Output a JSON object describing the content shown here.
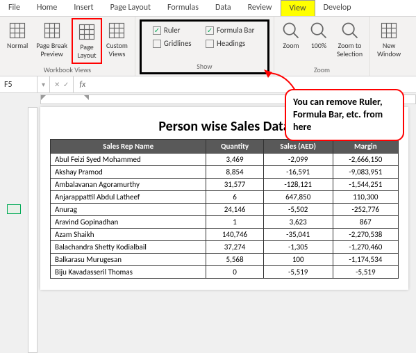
{
  "tabs": [
    "File",
    "Home",
    "Insert",
    "Page Layout",
    "Formulas",
    "Data",
    "Review",
    "View",
    "Develop"
  ],
  "active_tab": "View",
  "groups": {
    "workbook": {
      "label": "Workbook Views",
      "items": [
        "Normal",
        "Page Break\nPreview",
        "Page\nLayout",
        "Custom\nViews"
      ]
    },
    "show": {
      "label": "Show",
      "opts": [
        {
          "l": "Ruler",
          "c": true
        },
        {
          "l": "Formula Bar",
          "c": true
        },
        {
          "l": "Gridlines",
          "c": false
        },
        {
          "l": "Headings",
          "c": false
        }
      ]
    },
    "zoom": {
      "label": "Zoom",
      "items": [
        "Zoom",
        "100%",
        "Zoom to\nSelection"
      ]
    },
    "window": {
      "items": [
        "New\nWindow"
      ]
    }
  },
  "namebox": "F5",
  "fx": "fx",
  "callout": "You can remove Ruler, Formula Bar, etc. from here",
  "chart_data": {
    "type": "table",
    "title": "Person wise Sales Data",
    "columns": [
      "Sales Rep Name",
      "Quantity",
      "Sales (AED)",
      "Margin"
    ],
    "rows": [
      [
        "Abul Feizi Syed Mohammed",
        "3,469",
        "-2,099",
        "-2,666,150"
      ],
      [
        "Akshay Pramod",
        "8,854",
        "-16,591",
        "-9,083,951"
      ],
      [
        "Ambalavanan Agoramurthy",
        "31,577",
        "-128,121",
        "-1,544,251"
      ],
      [
        "Anjarappattil Abdul Latheef",
        "6",
        "647,850",
        "110,300"
      ],
      [
        "Anurag",
        "24,146",
        "-5,502",
        "-252,776"
      ],
      [
        "Aravind Gopinadhan",
        "1",
        "3,623",
        "867"
      ],
      [
        "Azam Shaikh",
        "140,746",
        "-35,041",
        "-2,270,538"
      ],
      [
        "Balachandra Shetty Kodialbail",
        "37,274",
        "-1,305",
        "-1,270,460"
      ],
      [
        "Balkarasu Murugesan",
        "5,568",
        "100",
        "-1,174,534"
      ],
      [
        "Biju Kavadasseril Thomas",
        "0",
        "-5,519",
        "-5,519"
      ]
    ]
  }
}
